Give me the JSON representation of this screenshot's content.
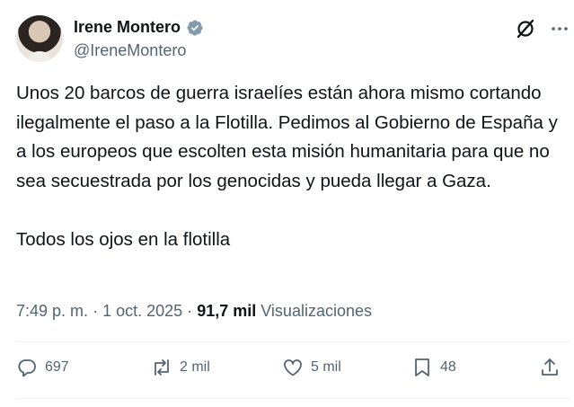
{
  "user": {
    "name": "Irene Montero",
    "handle": "@IreneMontero"
  },
  "tweet": {
    "text": "Unos 20 barcos de guerra israelíes están ahora mismo cortando ilegalmente el paso a la Flotilla. Pedimos al Gobierno de España y a los europeos que escolten esta misión humanitaria para que no sea secuestrada por los genocidas y pueda llegar a Gaza.\n\nTodos los ojos en la flotilla"
  },
  "meta": {
    "time": "7:49 p. m.",
    "separator": "·",
    "date": "1 oct. 2025",
    "views_count": "91,7 mil",
    "views_label": "Visualizaciones"
  },
  "actions": {
    "replies": "697",
    "reposts": "2 mil",
    "likes": "5 mil",
    "bookmarks": "48"
  },
  "colors": {
    "verified": "#829aab",
    "secondary_text": "#536471",
    "primary_text": "#0f1419",
    "divider": "#eff3f4"
  },
  "icons": [
    "verified-badge-icon",
    "grok-icon",
    "more-icon",
    "reply-icon",
    "repost-icon",
    "like-icon",
    "bookmark-icon",
    "share-icon"
  ]
}
